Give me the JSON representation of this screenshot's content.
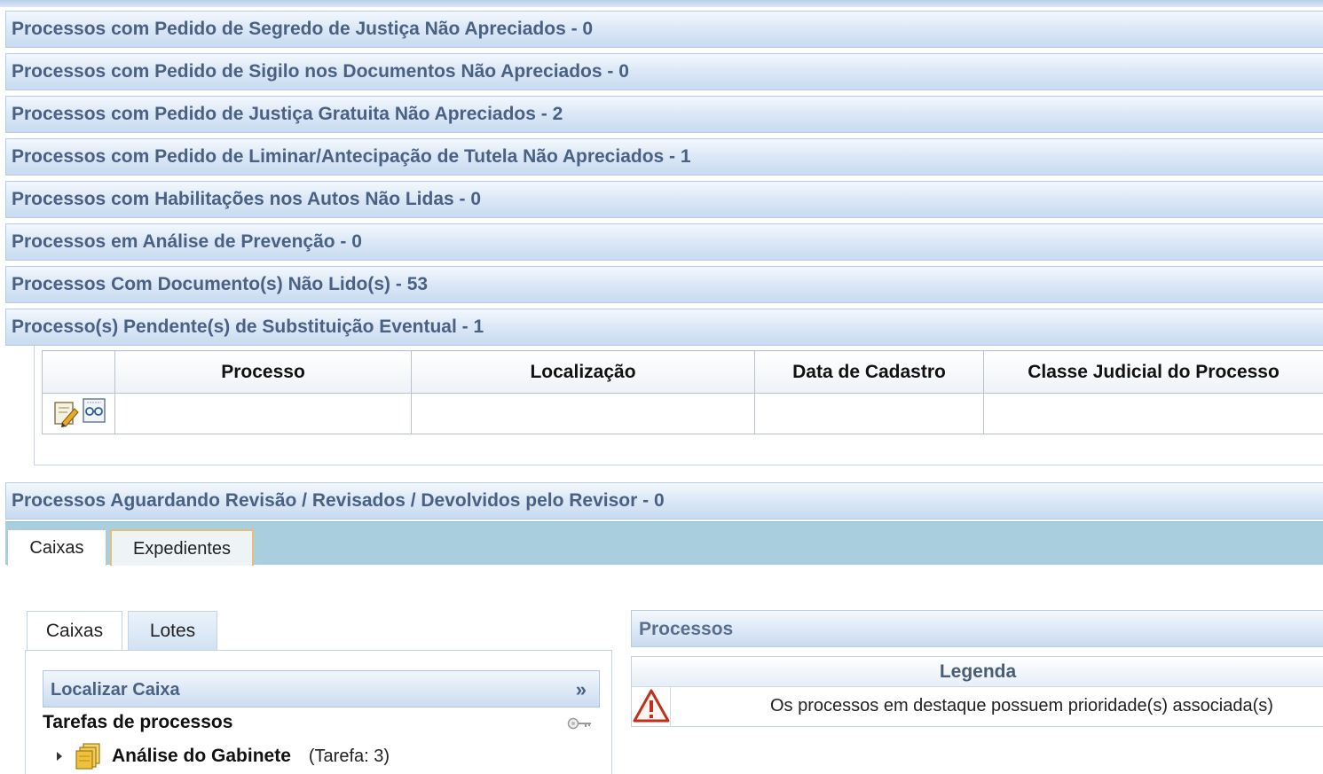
{
  "panels": [
    "Processos com Pedido de Segredo de Justiça Não Apreciados - 0",
    "Processos com Pedido de Sigilo nos Documentos Não Apreciados - 0",
    "Processos com Pedido de Justiça Gratuita Não Apreciados - 2",
    "Processos com Pedido de Liminar/Antecipação de Tutela Não Apreciados - 1",
    "Processos com Habilitações nos Autos Não Lidas - 0",
    "Processos em Análise de Prevenção - 0",
    "Processos Com Documento(s) Não Lido(s) - 53",
    "Processo(s) Pendente(s) de Substituição Eventual - 1",
    "Processos Aguardando Revisão / Revisados / Devolvidos pelo Revisor - 0"
  ],
  "table": {
    "columns": [
      "",
      "Processo",
      "Localização",
      "Data de Cadastro",
      "Classe Judicial do Processo"
    ],
    "row_icons": [
      "edit-document-icon",
      "view-details-icon"
    ]
  },
  "main_tabs": [
    "Caixas",
    "Expedientes"
  ],
  "inner_tabs": [
    "Caixas",
    "Lotes"
  ],
  "localizar": {
    "label": "Localizar Caixa",
    "toggle": "»"
  },
  "tarefas": {
    "title": "Tarefas de processos",
    "items": [
      {
        "name": "Análise do Gabinete",
        "count": "(Tarefa: 3)"
      }
    ]
  },
  "processos": {
    "title": "Processos",
    "legend_title": "Legenda",
    "legend_text": "Os processos em destaque possuem prioridade(s) associada(s)"
  }
}
